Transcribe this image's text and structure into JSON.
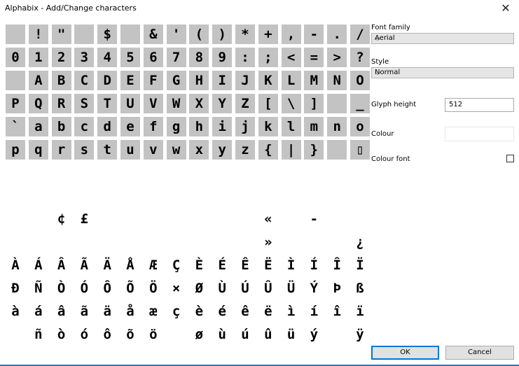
{
  "window": {
    "title": "Alphabix - Add/Change characters",
    "close_glyph": "✕"
  },
  "rows": [
    [
      "",
      "!",
      "\"",
      "",
      "$",
      "",
      "&",
      "'",
      "(",
      ")",
      "*",
      "+",
      ",",
      "-",
      ".",
      "/"
    ],
    [
      "0",
      "1",
      "2",
      "3",
      "4",
      "5",
      "6",
      "7",
      "8",
      "9",
      ":",
      ";",
      "<",
      "=",
      ">",
      "?"
    ],
    [
      "",
      "A",
      "B",
      "C",
      "D",
      "E",
      "F",
      "G",
      "H",
      "I",
      "J",
      "K",
      "L",
      "M",
      "N",
      "O"
    ],
    [
      "P",
      "Q",
      "R",
      "S",
      "T",
      "U",
      "V",
      "W",
      "X",
      "Y",
      "Z",
      "[",
      "\\",
      "]",
      "",
      "_"
    ],
    [
      "`",
      "a",
      "b",
      "c",
      "d",
      "e",
      "f",
      "g",
      "h",
      "i",
      "j",
      "k",
      "l",
      "m",
      "n",
      "o"
    ],
    [
      "p",
      "q",
      "r",
      "s",
      "t",
      "u",
      "v",
      "w",
      "x",
      "y",
      "z",
      "{",
      "|",
      "}",
      "",
      "▯"
    ],
    [
      "",
      "",
      "",
      "",
      "",
      "",
      "",
      "",
      "",
      "",
      "",
      "",
      "",
      "",
      "",
      ""
    ],
    [
      "",
      "",
      "",
      "",
      "",
      "",
      "",
      "",
      "",
      "",
      "",
      "",
      "",
      "",
      "",
      ""
    ],
    [
      "",
      "",
      "¢",
      "£",
      "",
      "",
      "",
      "",
      "",
      "",
      "",
      "«",
      "",
      "-",
      "",
      ""
    ],
    [
      "",
      "",
      "",
      "",
      "",
      "",
      "",
      "",
      "",
      "",
      "",
      "»",
      "",
      "",
      "",
      "¿"
    ],
    [
      "À",
      "Á",
      "Â",
      "Ã",
      "Ä",
      "Å",
      "Æ",
      "Ç",
      "È",
      "É",
      "Ê",
      "Ë",
      "Ì",
      "Í",
      "Î",
      "Ï"
    ],
    [
      "Ð",
      "Ñ",
      "Ò",
      "Ó",
      "Ô",
      "Õ",
      "Ö",
      "×",
      "Ø",
      "Ù",
      "Ú",
      "Û",
      "Ü",
      "Ý",
      "Þ",
      "ß"
    ],
    [
      "à",
      "á",
      "â",
      "ã",
      "ä",
      "å",
      "æ",
      "ç",
      "è",
      "é",
      "ê",
      "ë",
      "ì",
      "í",
      "î",
      "ï"
    ],
    [
      "",
      "ñ",
      "ò",
      "ó",
      "ô",
      "õ",
      "ö",
      "",
      "ø",
      "ù",
      "ú",
      "û",
      "ü",
      "ý",
      "",
      "ÿ"
    ]
  ],
  "gray_rows": [
    0,
    1,
    2,
    3,
    4,
    5
  ],
  "panel": {
    "font_family_label": "Font family",
    "font_family_value": "Aerial",
    "style_label": "Style",
    "style_value": "Normal",
    "glyph_height_label": "Glyph height",
    "glyph_height_value": "512",
    "colour_label": "Colour",
    "colour_font_label": "Colour font",
    "ok_label": "OK",
    "cancel_label": "Cancel",
    "chevron_glyph": "⌵"
  }
}
